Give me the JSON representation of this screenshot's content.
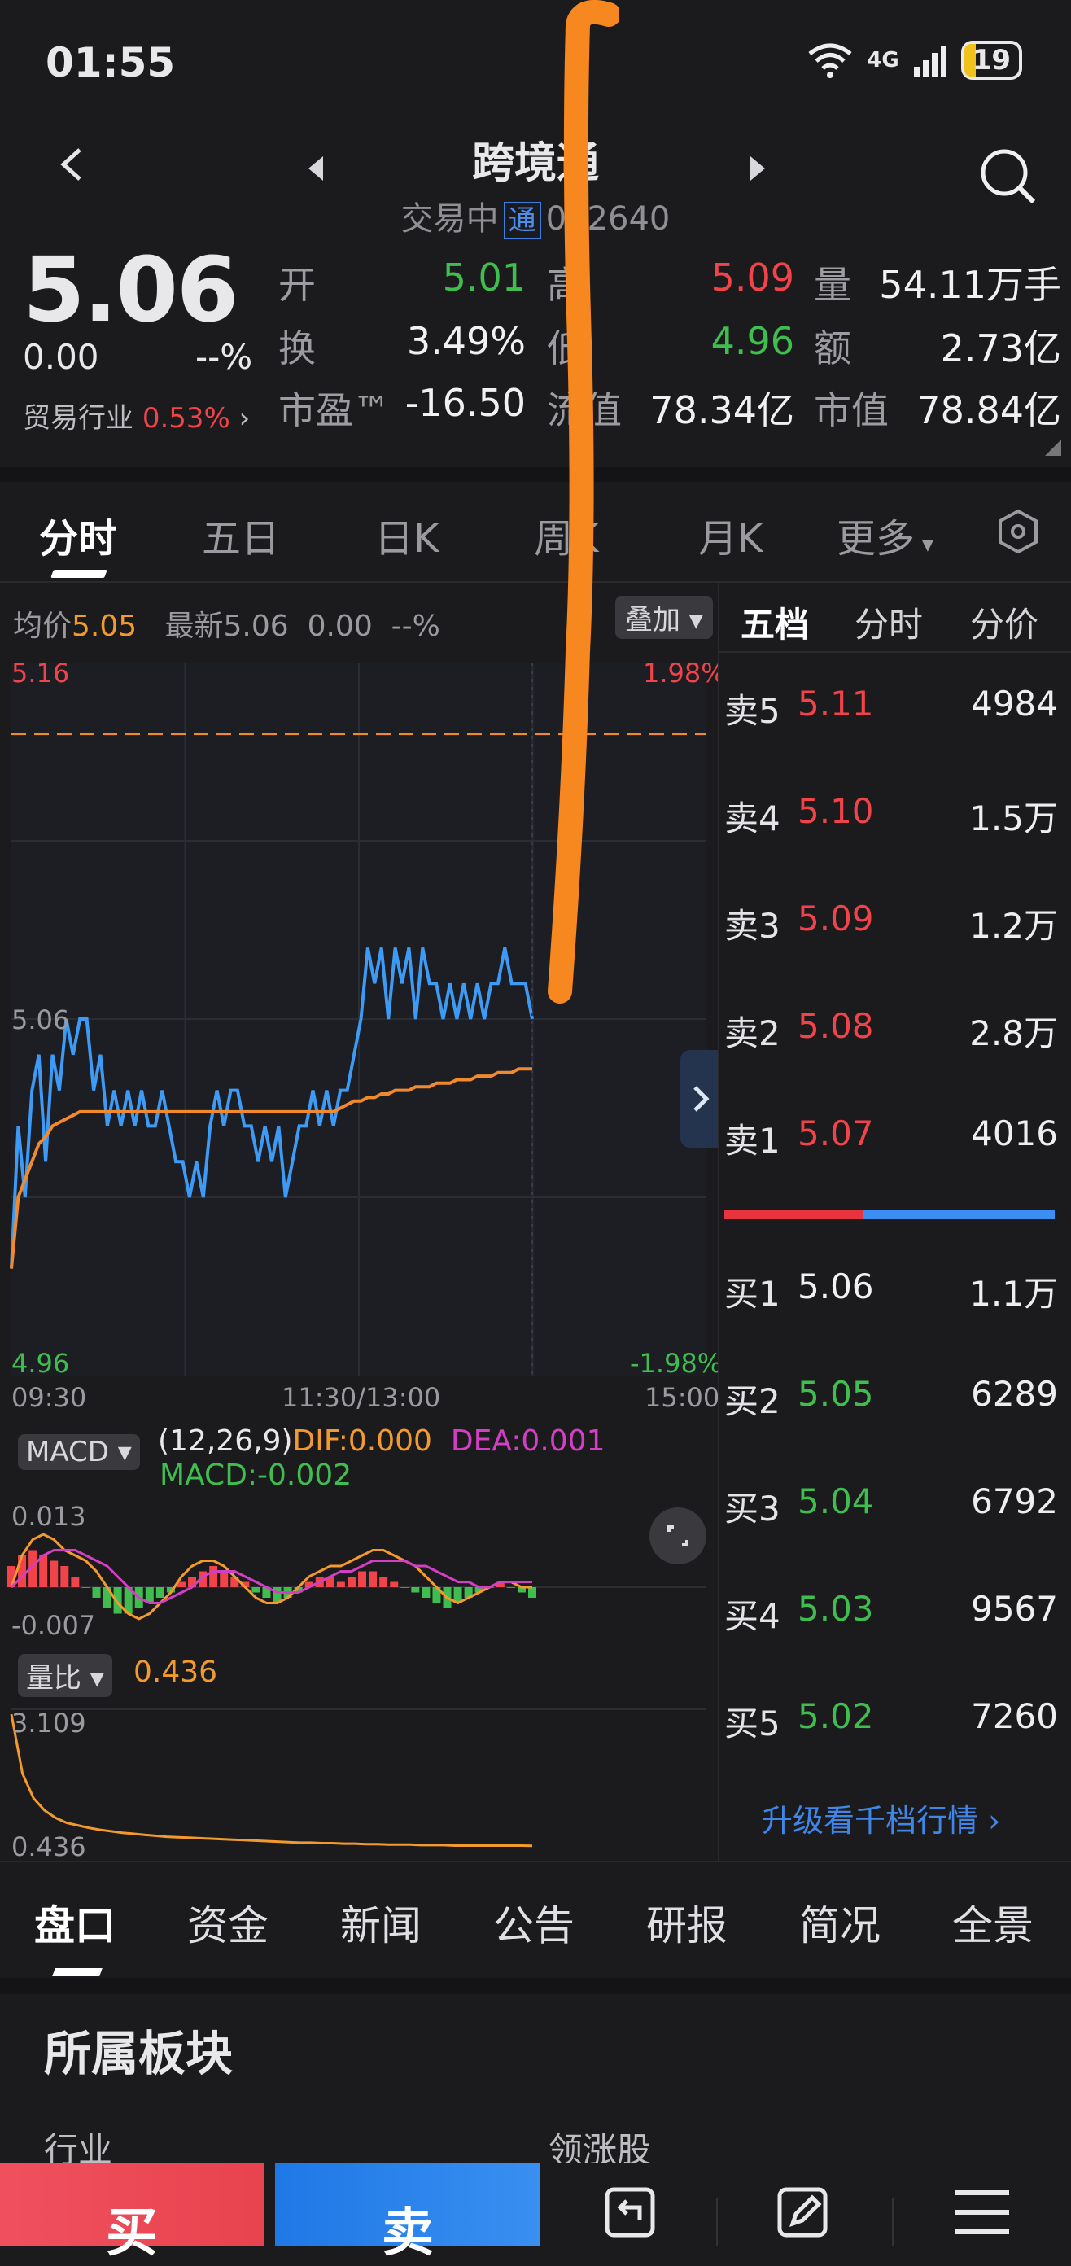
{
  "status": {
    "time": "01:55",
    "battery": "19",
    "network": "4G"
  },
  "header": {
    "title": "跨境通",
    "trading_state": "交易中",
    "tong_badge": "通",
    "code": "002640"
  },
  "quote": {
    "price": "5.06",
    "change_abs": "0.00",
    "change_pct": "--%",
    "industry_label": "贸易行业",
    "industry_pct": "0.53%",
    "fields": [
      {
        "label": "开",
        "value": "5.01",
        "color": "green"
      },
      {
        "label": "高",
        "value": "5.09",
        "color": "red"
      },
      {
        "label": "量",
        "value": "54.11万手",
        "color": "white"
      },
      {
        "label": "换",
        "value": "3.49%",
        "color": "white"
      },
      {
        "label": "低",
        "value": "4.96",
        "color": "green"
      },
      {
        "label": "额",
        "value": "2.73亿",
        "color": "white"
      },
      {
        "label": "市盈™",
        "value": "-16.50",
        "color": "white"
      },
      {
        "label": "流值",
        "value": "78.34亿",
        "color": "white"
      },
      {
        "label": "市值",
        "value": "78.84亿",
        "color": "white"
      }
    ]
  },
  "tabs": [
    "分时",
    "五日",
    "日K",
    "周K",
    "月K",
    "更多"
  ],
  "chart_info": {
    "avg_label": "均价",
    "avg_value": "5.05",
    "latest_label": "最新",
    "latest_value": "5.06",
    "latest_change": "0.00",
    "latest_pct": "--%",
    "overlay_label": "叠加"
  },
  "chart_data": {
    "type": "line",
    "ylim": [
      4.96,
      5.16
    ],
    "y_ticks": [
      "5.16",
      "5.06",
      "4.96"
    ],
    "pct_ticks": [
      "1.98%",
      "-1.98%"
    ],
    "x_ticks": [
      "09:30",
      "11:30/13:00",
      "15:00"
    ],
    "reference_line": 5.14,
    "series": [
      {
        "name": "最新",
        "color": "#3d9bf5",
        "values": [
          4.99,
          5.03,
          5.01,
          5.04,
          5.05,
          5.02,
          5.05,
          5.04,
          5.06,
          5.05,
          5.06,
          5.06,
          5.04,
          5.05,
          5.03,
          5.04,
          5.03,
          5.04,
          5.03,
          5.04,
          5.03,
          5.03,
          5.04,
          5.03,
          5.02,
          5.02,
          5.01,
          5.02,
          5.01,
          5.03,
          5.04,
          5.03,
          5.04,
          5.04,
          5.03,
          5.03,
          5.02,
          5.03,
          5.02,
          5.03,
          5.01,
          5.02,
          5.03,
          5.03,
          5.04,
          5.03,
          5.04,
          5.03,
          5.04,
          5.04,
          5.05,
          5.06,
          5.08,
          5.07,
          5.08,
          5.06,
          5.08,
          5.07,
          5.08,
          5.06,
          5.08,
          5.07,
          5.07,
          5.06,
          5.07,
          5.06,
          5.07,
          5.06,
          5.07,
          5.06,
          5.07,
          5.07,
          5.08,
          5.07,
          5.07,
          5.07,
          5.06
        ]
      },
      {
        "name": "均价",
        "color": "#f08a2c",
        "values": [
          4.99,
          5.01,
          5.015,
          5.02,
          5.025,
          5.027,
          5.03,
          5.031,
          5.032,
          5.033,
          5.034,
          5.034,
          5.034,
          5.034,
          5.034,
          5.034,
          5.034,
          5.034,
          5.034,
          5.034,
          5.034,
          5.034,
          5.034,
          5.034,
          5.034,
          5.034,
          5.034,
          5.034,
          5.034,
          5.034,
          5.034,
          5.034,
          5.034,
          5.034,
          5.034,
          5.034,
          5.034,
          5.034,
          5.034,
          5.034,
          5.034,
          5.034,
          5.034,
          5.034,
          5.034,
          5.034,
          5.034,
          5.034,
          5.035,
          5.036,
          5.037,
          5.037,
          5.038,
          5.038,
          5.039,
          5.039,
          5.04,
          5.04,
          5.04,
          5.041,
          5.041,
          5.041,
          5.042,
          5.042,
          5.042,
          5.043,
          5.043,
          5.043,
          5.044,
          5.044,
          5.044,
          5.045,
          5.045,
          5.045,
          5.046,
          5.046,
          5.046
        ]
      }
    ]
  },
  "macd": {
    "button": "MACD",
    "params": "(12,26,9)",
    "dif": "DIF:0.000",
    "dea": "DEA:0.001",
    "macd": "MACD:-0.002",
    "y_top": "0.013",
    "y_bottom": "-0.007",
    "bars": [
      0.004,
      0.006,
      0.007,
      0.006,
      0.005,
      0.004,
      0.002,
      0.0,
      -0.002,
      -0.004,
      -0.005,
      -0.005,
      -0.004,
      -0.003,
      -0.002,
      -0.001,
      0.001,
      0.002,
      0.003,
      0.004,
      0.003,
      0.002,
      0.001,
      -0.001,
      -0.002,
      -0.003,
      -0.002,
      -0.001,
      0.001,
      0.002,
      0.002,
      0.001,
      0.002,
      0.003,
      0.003,
      0.002,
      0.001,
      0.0,
      -0.001,
      -0.002,
      -0.003,
      -0.004,
      -0.003,
      -0.002,
      -0.001,
      0.0,
      0.001,
      0.0,
      -0.001,
      -0.002
    ],
    "dif_line": [
      0.0,
      0.006,
      0.009,
      0.01,
      0.009,
      0.007,
      0.006,
      0.005,
      0.003,
      0.0,
      -0.003,
      -0.005,
      -0.006,
      -0.005,
      -0.003,
      -0.001,
      0.002,
      0.004,
      0.005,
      0.005,
      0.004,
      0.002,
      0.0,
      -0.002,
      -0.003,
      -0.003,
      -0.002,
      0.0,
      0.002,
      0.003,
      0.004,
      0.004,
      0.005,
      0.006,
      0.007,
      0.007,
      0.006,
      0.005,
      0.004,
      0.002,
      0.0,
      -0.002,
      -0.003,
      -0.002,
      -0.001,
      0.0,
      0.001,
      0.001,
      0.0,
      0.0
    ],
    "dea_line": [
      0.0,
      0.002,
      0.004,
      0.006,
      0.007,
      0.007,
      0.007,
      0.006,
      0.005,
      0.004,
      0.002,
      0.0,
      -0.002,
      -0.003,
      -0.003,
      -0.002,
      -0.001,
      0.0,
      0.002,
      0.003,
      0.003,
      0.003,
      0.002,
      0.001,
      0.0,
      -0.001,
      -0.001,
      -0.001,
      0.0,
      0.001,
      0.002,
      0.003,
      0.003,
      0.004,
      0.005,
      0.005,
      0.005,
      0.005,
      0.004,
      0.004,
      0.003,
      0.002,
      0.001,
      0.001,
      0.0,
      0.0,
      0.001,
      0.001,
      0.001,
      0.001
    ]
  },
  "volume_ratio": {
    "button": "量比",
    "value": "0.436",
    "y_top": "3.109",
    "y_bottom": "0.436",
    "values": [
      3.1,
      1.9,
      1.4,
      1.15,
      1.0,
      0.9,
      0.85,
      0.8,
      0.76,
      0.73,
      0.7,
      0.68,
      0.66,
      0.64,
      0.62,
      0.61,
      0.6,
      0.59,
      0.58,
      0.57,
      0.56,
      0.55,
      0.54,
      0.53,
      0.52,
      0.51,
      0.5,
      0.5,
      0.49,
      0.49,
      0.48,
      0.48,
      0.47,
      0.47,
      0.46,
      0.46,
      0.46,
      0.45,
      0.45,
      0.45,
      0.44,
      0.44,
      0.44,
      0.44,
      0.44,
      0.44,
      0.44,
      0.436
    ]
  },
  "order_book": {
    "tabs": [
      "五档",
      "分时",
      "分价"
    ],
    "asks": [
      {
        "label": "卖5",
        "price": "5.11",
        "volume": "4984"
      },
      {
        "label": "卖4",
        "price": "5.10",
        "volume": "1.5万"
      },
      {
        "label": "卖3",
        "price": "5.09",
        "volume": "1.2万"
      },
      {
        "label": "卖2",
        "price": "5.08",
        "volume": "2.8万"
      },
      {
        "label": "卖1",
        "price": "5.07",
        "volume": "4016"
      }
    ],
    "bids": [
      {
        "label": "买1",
        "price": "5.06",
        "volume": "1.1万",
        "color": "white"
      },
      {
        "label": "买2",
        "price": "5.05",
        "volume": "6289",
        "color": "green"
      },
      {
        "label": "买3",
        "price": "5.04",
        "volume": "6792",
        "color": "green"
      },
      {
        "label": "买4",
        "price": "5.03",
        "volume": "9567",
        "color": "green"
      },
      {
        "label": "买5",
        "price": "5.02",
        "volume": "7260",
        "color": "green"
      }
    ],
    "buy_ratio": 0.42,
    "upgrade_link": "升级看千档行情"
  },
  "bottom_tabs": [
    "盘口",
    "资金",
    "新闻",
    "公告",
    "研报",
    "简况",
    "全景"
  ],
  "section": {
    "title": "所属板块",
    "col_industry": "行业",
    "col_leader": "领涨股"
  },
  "actions": {
    "buy": "买",
    "sell": "卖"
  },
  "colors": {
    "red": "#f0434a",
    "green": "#3fbe4f",
    "blue": "#3d9bf5",
    "orange": "#f08a2c",
    "annotation": "#f7871f"
  }
}
